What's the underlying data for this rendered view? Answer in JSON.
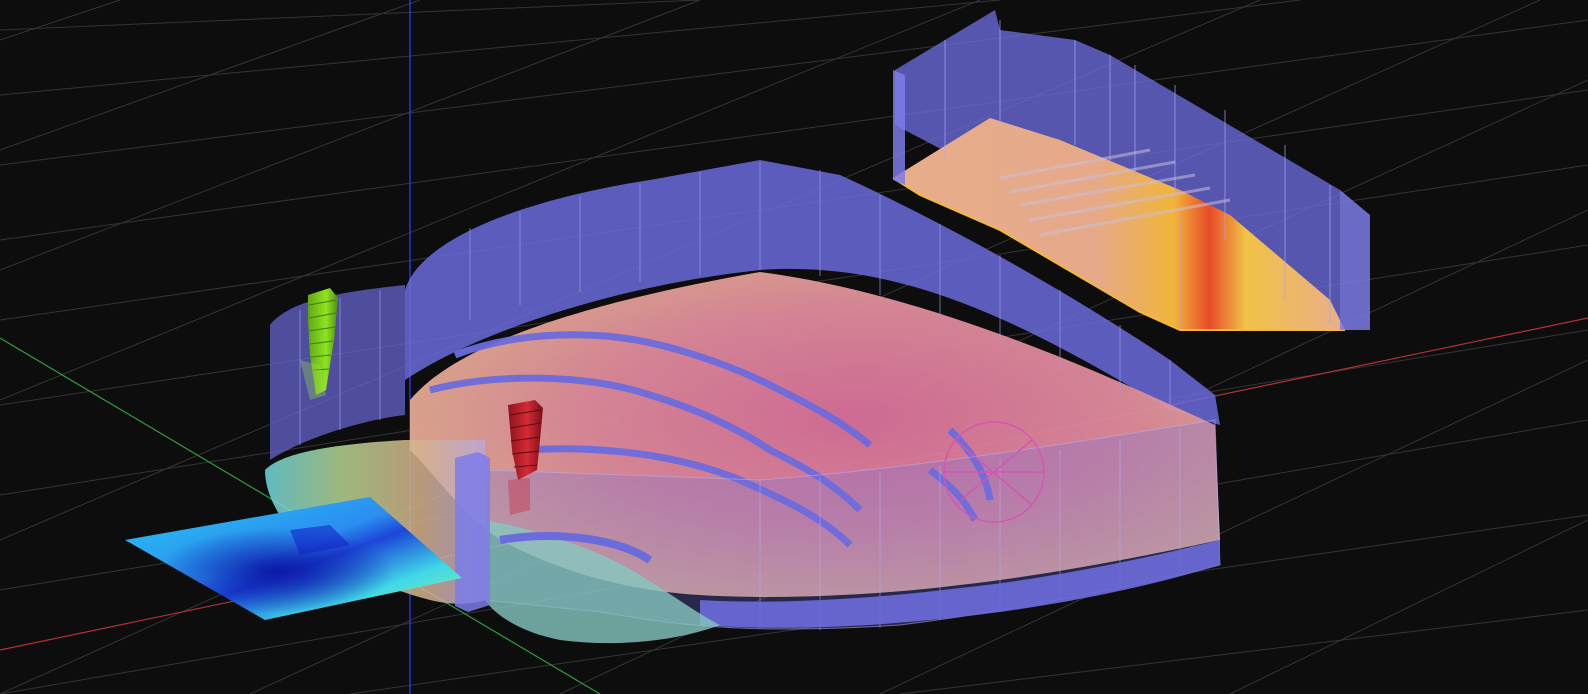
{
  "viewport": {
    "background": "#0d0d0d",
    "grid_color": "#3a3a3a",
    "axis_colors": {
      "x": "#c23b3b",
      "y": "#2f9e3a",
      "z": "#2b35d6"
    }
  },
  "scene": {
    "wall_color": "#6f6fe0",
    "floor_color": "#e4a98f",
    "floor_hot_color": "#d9789a",
    "heatmap_colors": [
      "#1a3bd8",
      "#27b6f2",
      "#57f0d0",
      "#a9f07a",
      "#f4d35e",
      "#f08a2b",
      "#e63b2e"
    ],
    "speaker_colors": {
      "left": "#7fd41c",
      "center": "#c8202d"
    },
    "target_color": "#d455b5"
  }
}
